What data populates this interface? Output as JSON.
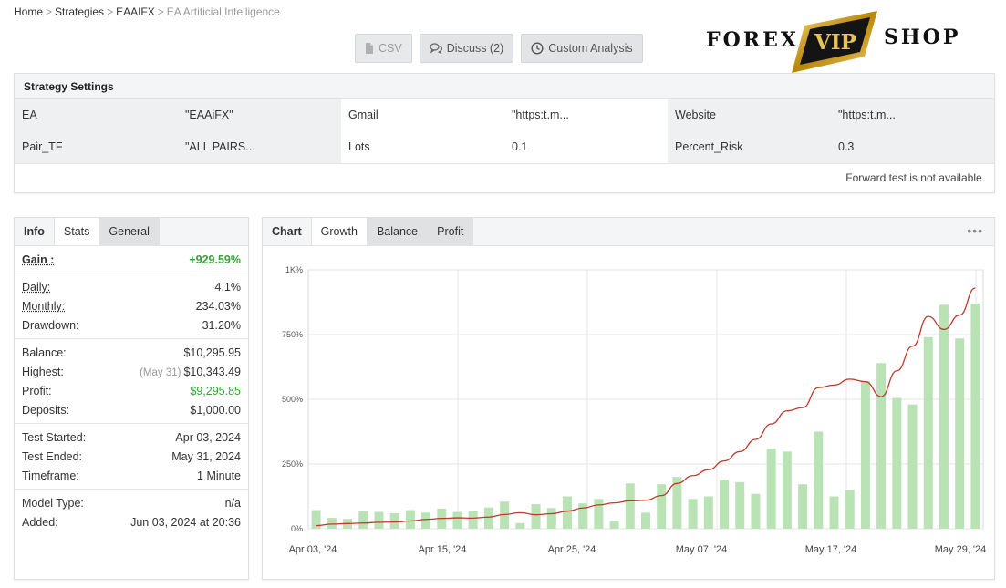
{
  "breadcrumb": {
    "items": [
      "Home",
      "Strategies",
      "EAAIFX"
    ],
    "separator": ">",
    "current": "EA Artificial Intelligence"
  },
  "toolbar": {
    "csv": "CSV",
    "discuss": "Discuss (2)",
    "custom": "Custom Analysis"
  },
  "logo": {
    "left": "FOREX",
    "badge": "VIP",
    "right": "SHOP"
  },
  "settings": {
    "title": "Strategy Settings",
    "columns": [
      [
        {
          "k": "EA",
          "v": "\"EAAiFX\""
        },
        {
          "k": "Pair_TF",
          "v": "\"ALL PAIRS..."
        }
      ],
      [
        {
          "k": "Gmail",
          "v": "\"https:t.m..."
        },
        {
          "k": "Lots",
          "v": "0.1"
        }
      ],
      [
        {
          "k": "Website",
          "v": "\"https:t.m..."
        },
        {
          "k": "Percent_Risk",
          "v": "0.3"
        }
      ]
    ],
    "footer": "Forward test is not available."
  },
  "info": {
    "tabs": [
      "Info",
      "Stats",
      "General"
    ],
    "gain_label": "Gain :",
    "gain_value": "+929.59%",
    "daily_label": "Daily:",
    "daily": "4.1%",
    "monthly_label": "Monthly:",
    "monthly": "234.03%",
    "drawdown_label": "Drawdown:",
    "drawdown": "31.20%",
    "balance_label": "Balance:",
    "balance": "$10,295.95",
    "highest_label": "Highest:",
    "highest_note": "(May 31)",
    "highest": "$10,343.49",
    "profit_label": "Profit:",
    "profit": "$9,295.85",
    "deposits_label": "Deposits:",
    "deposits": "$1,000.00",
    "test_started_label": "Test Started:",
    "test_started": "Apr 03, 2024",
    "test_ended_label": "Test Ended:",
    "test_ended": "May 31, 2024",
    "timeframe_label": "Timeframe:",
    "timeframe": "1 Minute",
    "model_label": "Model Type:",
    "model": "n/a",
    "added_label": "Added:",
    "added": "Jun 03, 2024 at 20:36"
  },
  "chart_panel": {
    "tabs": [
      "Chart",
      "Growth",
      "Balance",
      "Profit"
    ],
    "more": "•••"
  },
  "chart_data": {
    "type": "bar",
    "yticks": [
      "0%",
      "250%",
      "500%",
      "750%",
      "1K%"
    ],
    "ylim": [
      0,
      1000
    ],
    "xticks": [
      "Apr 03, '24",
      "Apr 15, '24",
      "Apr 25, '24",
      "May 07, '24",
      "May 17, '24",
      "May 29, '24"
    ],
    "grid": true,
    "bar_color": "#b9e3b5",
    "line_color": "#c0392b",
    "bars": [
      72,
      42,
      38,
      68,
      65,
      60,
      72,
      62,
      78,
      65,
      70,
      82,
      105,
      22,
      95,
      80,
      125,
      98,
      115,
      30,
      175,
      62,
      172,
      200,
      115,
      125,
      188,
      180,
      135,
      310,
      298,
      172,
      375,
      125,
      150,
      570,
      640,
      505,
      480,
      740,
      865,
      735,
      870
    ],
    "growth": [
      12,
      18,
      20,
      22,
      25,
      26,
      30,
      36,
      40,
      42,
      41,
      45,
      55,
      62,
      54,
      58,
      68,
      80,
      92,
      100,
      108,
      110,
      128,
      175,
      205,
      228,
      262,
      298,
      345,
      405,
      455,
      468,
      545,
      555,
      578,
      568,
      510,
      610,
      705,
      820,
      770,
      825,
      930
    ]
  }
}
